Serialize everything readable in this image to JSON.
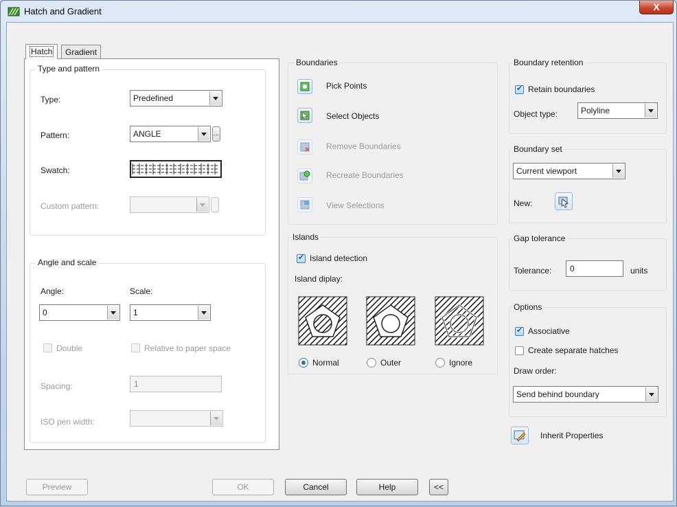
{
  "window": {
    "title": "Hatch and Gradient",
    "close_glyph": "X"
  },
  "tabs": [
    {
      "label": "Hatch"
    },
    {
      "label": "Gradient"
    }
  ],
  "type_pattern": {
    "title": "Type and pattern",
    "type_label": "Type:",
    "type_value": "Predefined",
    "pattern_label": "Pattern:",
    "pattern_value": "ANGLE",
    "pattern_browse": "...",
    "swatch_label": "Swatch:",
    "custom_label": "Custom pattern:"
  },
  "angle_scale": {
    "title": "Angle and scale",
    "angle_label": "Angle:",
    "angle_value": "0",
    "scale_label": "Scale:",
    "scale_value": "1",
    "double_label": "Double",
    "relative_label": "Relative to paper space",
    "spacing_label": "Spacing:",
    "spacing_value": "1",
    "iso_label": "ISO pen width:"
  },
  "boundaries": {
    "title": "Boundaries",
    "items": [
      {
        "label": "Pick Points",
        "icon": "pick-points-icon",
        "enabled": true
      },
      {
        "label": "Select Objects",
        "icon": "select-objects-icon",
        "enabled": true
      },
      {
        "label": "Remove Boundaries",
        "icon": "remove-boundaries-icon",
        "enabled": false
      },
      {
        "label": "Recreate Boundaries",
        "icon": "recreate-boundaries-icon",
        "enabled": false
      },
      {
        "label": "View Selections",
        "icon": "view-selections-icon",
        "enabled": false
      }
    ]
  },
  "islands": {
    "title": "Islands",
    "detection_label": "Island detection",
    "detection_checked": true,
    "display_label": "Island diplay:",
    "styles": [
      {
        "label": "Normal",
        "selected": true
      },
      {
        "label": "Outer",
        "selected": false
      },
      {
        "label": "Ignore",
        "selected": false
      }
    ]
  },
  "retention": {
    "title": "Boundary retention",
    "retain_label": "Retain boundaries",
    "retain_checked": true,
    "object_type_label": "Object type:",
    "object_type_value": "Polyline"
  },
  "boundary_set": {
    "title": "Boundary set",
    "value": "Current viewport",
    "new_label": "New:"
  },
  "gap": {
    "title": "Gap tolerance",
    "tolerance_label": "Tolerance:",
    "tolerance_value": "0",
    "units_label": "units"
  },
  "options": {
    "title": "Options",
    "associative_label": "Associative",
    "associative_checked": true,
    "separate_label": "Create separate hatches",
    "separate_checked": false,
    "draw_order_label": "Draw order:",
    "draw_order_value": "Send behind boundary"
  },
  "inherit_label": "Inherit Properties",
  "footer": {
    "preview": "Preview",
    "ok": "OK",
    "cancel": "Cancel",
    "help": "Help",
    "collapse": "<<"
  },
  "colors": {
    "title_bg": "#c6d7ee",
    "close_red": "#c94a35",
    "accent_blue": "#2f6fb0"
  }
}
